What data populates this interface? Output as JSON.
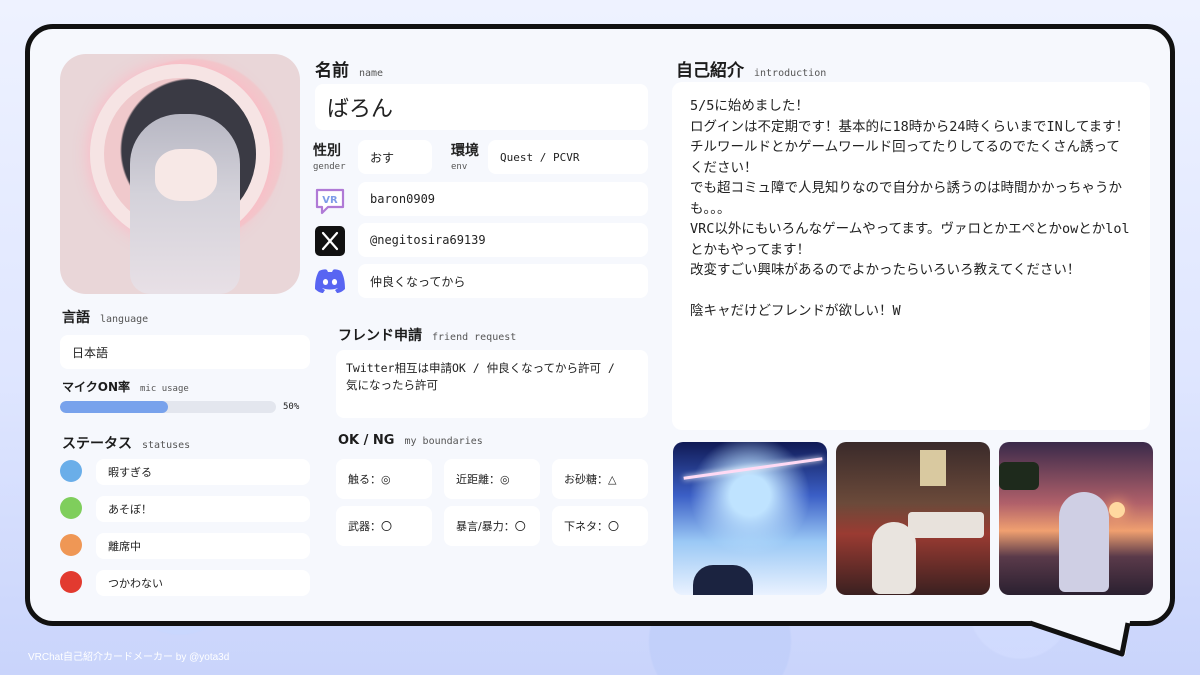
{
  "profile": {
    "name_heading": "名前",
    "name_heading_sub": "name",
    "name": "ばろん",
    "gender_label": "性別",
    "gender_label_sub": "gender",
    "gender": "おす",
    "env_label": "環境",
    "env_label_sub": "env",
    "env": "Quest / PCVR",
    "vrchat_id": "baron0909",
    "x_handle": "@negitosira69139",
    "discord_note": "仲良くなってから"
  },
  "language": {
    "heading": "言語",
    "heading_sub": "language",
    "value": "日本語"
  },
  "mic": {
    "heading": "マイクON率",
    "heading_sub": "mic usage",
    "percent_label": "50%",
    "fraction": 0.5
  },
  "statuses": {
    "heading": "ステータス",
    "heading_sub": "statuses",
    "items": [
      {
        "label": "暇すぎる",
        "color": "#6aaee9"
      },
      {
        "label": "あそぼ！",
        "color": "#7fce5c"
      },
      {
        "label": "離席中",
        "color": "#ef9755"
      },
      {
        "label": "つかわない",
        "color": "#e23a2f"
      }
    ]
  },
  "friend_request": {
    "heading": "フレンド申請",
    "heading_sub": "friend request",
    "text": "Twitter相互は申請OK / 仲良くなってから許可 /\n気になったら許可"
  },
  "boundaries": {
    "heading": "OK / NG",
    "heading_sub": "my boundaries",
    "items": [
      "触る：◎",
      "近距離：◎",
      "お砂糖：△",
      "武器：〇",
      "暴言/暴力：〇",
      "下ネタ：〇"
    ]
  },
  "introduction": {
    "heading": "自己紹介",
    "heading_sub": "introduction",
    "text": "5/5に始めました！\nログインは不定期です！基本的に18時から24時くらいまでINしてます！\nチルワールドとかゲームワールド回ってたりしてるのでたくさん誘ってください！\nでも超コミュ障で人見知りなので自分から誘うのは時間かかっちゃうかも。。。\nVRC以外にもいろんなゲームやってます。ヴァロとかエペとかowとかlolとかもやってます！\n改変すごい興味があるのでよかったらいろいろ教えてください！\n\n陰キャだけどフレンドが欲しい！W"
  },
  "footer": {
    "credit": "VRChat自己紹介カードメーカー by @yota3d"
  },
  "icons": {
    "vrchat": "vrchat-icon",
    "x": "x-logo-icon",
    "discord": "discord-icon"
  }
}
